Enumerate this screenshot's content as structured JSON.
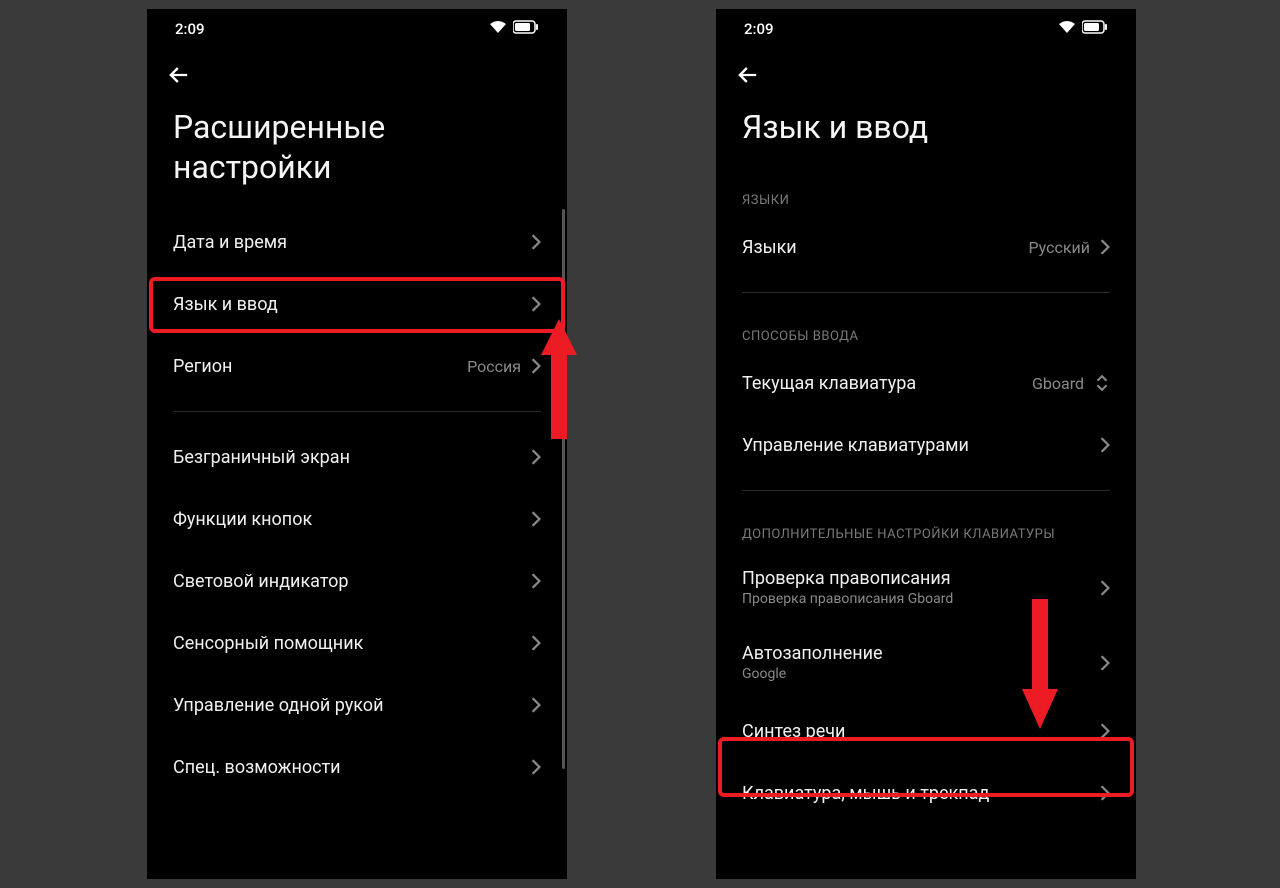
{
  "status": {
    "time": "2:09"
  },
  "left": {
    "title": "Расширенные настройки",
    "items": {
      "date_time": "Дата и время",
      "lang_input": "Язык и ввод",
      "region": "Регион",
      "region_value": "Россия",
      "fullscreen": "Безграничный экран",
      "button_fn": "Функции кнопок",
      "led": "Световой индикатор",
      "sensor_assist": "Сенсорный помощник",
      "one_hand": "Управление одной рукой",
      "accessibility": "Спец. возможности"
    }
  },
  "right": {
    "title": "Язык и ввод",
    "sections": {
      "languages": "ЯЗЫКИ",
      "input_methods": "СПОСОБЫ ВВОДА",
      "extra_kb": "ДОПОЛНИТЕЛЬНЫЕ НАСТРОЙКИ КЛАВИАТУРЫ"
    },
    "items": {
      "languages": "Языки",
      "languages_value": "Русский",
      "current_kb": "Текущая клавиатура",
      "current_kb_value": "Gboard",
      "manage_kb": "Управление клавиатурами",
      "spellcheck": "Проверка правописания",
      "spellcheck_sub": "Проверка правописания Gboard",
      "autofill": "Автозаполнение",
      "autofill_sub": "Google",
      "tts": "Синтез речи",
      "kbd_mouse": "Клавиатура, мышь и трекпад"
    }
  }
}
